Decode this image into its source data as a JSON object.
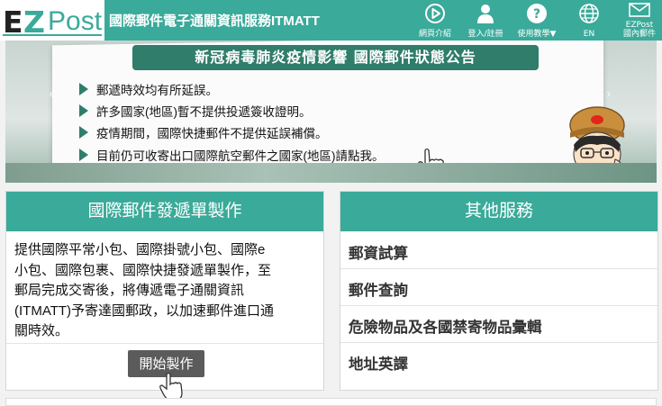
{
  "header": {
    "logo_ez_e": "E",
    "logo_ez_z": "Z",
    "logo_post": "Post",
    "title": "國際郵件電子通關資訊服務ITMATT",
    "nav": [
      {
        "label": "網頁介紹",
        "icon": "play-circle-icon"
      },
      {
        "label": "登入/註冊",
        "icon": "user-icon"
      },
      {
        "label": "使用教學▼",
        "icon": "help-icon"
      },
      {
        "label": "EN",
        "icon": "globe-icon"
      },
      {
        "label_line1": "EZPost",
        "label_line2": "國內郵件",
        "icon": "envelope-icon"
      }
    ]
  },
  "banner": {
    "title": "新冠病毒肺炎疫情影響 國際郵件狀態公告",
    "bullets": [
      "郵遞時效均有所延誤。",
      "許多國家(地區)暫不提供投遞簽收證明。",
      "疫情期間，國際快捷郵件不提供延誤補償。",
      "目前仍可收寄出口國際航空郵件之國家(地區)請點我。"
    ]
  },
  "left_panel": {
    "title": "國際郵件發遞單製作",
    "description_lines": [
      "提供國際平常小包、國際掛號小包、國際e",
      "小包、國際包裹、國際快捷發遞單製作，至",
      "郵局完成交寄後，將傳遞電子通關資訊",
      "(ITMATT)予寄達國郵政，以加速郵件進口通",
      "關時效。"
    ],
    "button_label": "開始製作"
  },
  "right_panel": {
    "title": "其他服務",
    "items": [
      "郵資試算",
      "郵件查詢",
      "危險物品及各國禁寄物品彙輯",
      "地址英譯"
    ]
  },
  "colors": {
    "brand": "#3aaa9a",
    "banner_title": "#2f7d6a",
    "button": "#5b5b5b"
  }
}
